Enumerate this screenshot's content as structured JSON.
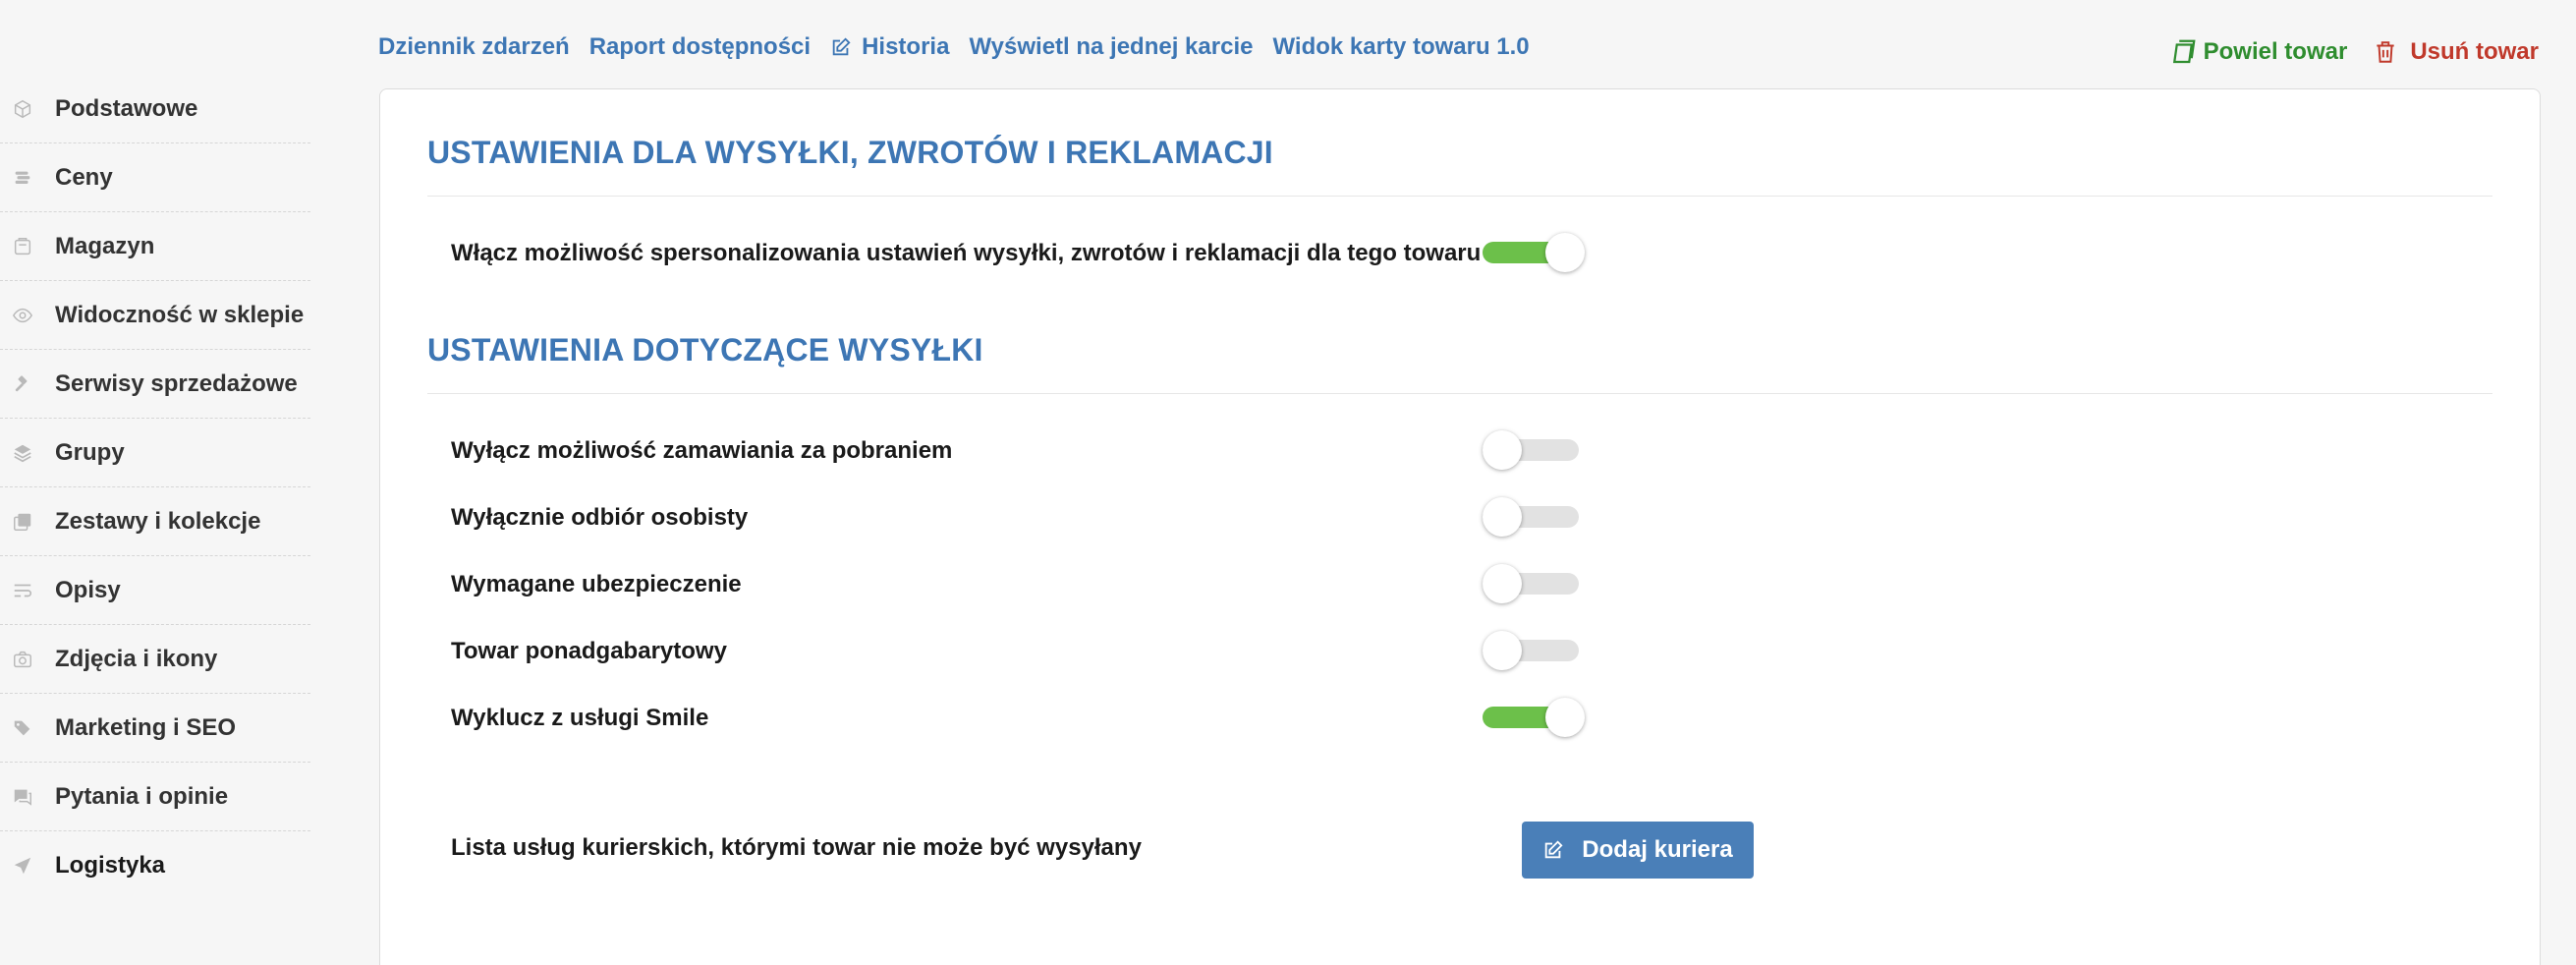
{
  "sidebar": {
    "items": [
      {
        "label": "Podstawowe",
        "icon": "box-icon"
      },
      {
        "label": "Ceny",
        "icon": "coins-icon"
      },
      {
        "label": "Magazyn",
        "icon": "warehouse-icon"
      },
      {
        "label": "Widoczność w sklepie",
        "icon": "eye-icon"
      },
      {
        "label": "Serwisy sprzedażowe",
        "icon": "gavel-icon"
      },
      {
        "label": "Grupy",
        "icon": "layers-icon"
      },
      {
        "label": "Zestawy i kolekcje",
        "icon": "collection-icon"
      },
      {
        "label": "Opisy",
        "icon": "text-wrap-icon"
      },
      {
        "label": "Zdjęcia i ikony",
        "icon": "camera-icon"
      },
      {
        "label": "Marketing i SEO",
        "icon": "tags-icon"
      },
      {
        "label": "Pytania i opinie",
        "icon": "comments-icon"
      },
      {
        "label": "Logistyka",
        "icon": "paper-plane-icon",
        "active": true
      }
    ]
  },
  "toplinks": {
    "event_log": "Dziennik zdarzeń",
    "availability_report": "Raport dostępności",
    "history": "Historia",
    "single_card": "Wyświetl na jednej karcie",
    "card_view": "Widok karty towaru 1.0"
  },
  "actions": {
    "duplicate": "Powiel towar",
    "delete": "Usuń towar"
  },
  "colors": {
    "accent": "#3d76b4",
    "toggle_on": "#6cc04a",
    "duplicate": "#2f8d2f",
    "delete": "#c0392b",
    "button": "#4a7fb8"
  },
  "section1": {
    "title": "USTAWIENIA DLA WYSYŁKI, ZWROTÓW I REKLAMACJI",
    "personalize_label": "Włącz możliwość spersonalizowania ustawień wysyłki, zwrotów i reklamacji dla tego towaru",
    "personalize_on": true
  },
  "section2": {
    "title": "USTAWIENIA DOTYCZĄCE WYSYŁKI",
    "options": [
      {
        "label": "Wyłącz możliwość zamawiania za pobraniem",
        "on": false
      },
      {
        "label": "Wyłącznie odbiór osobisty",
        "on": false
      },
      {
        "label": "Wymagane ubezpieczenie",
        "on": false
      },
      {
        "label": "Towar ponadgabarytowy",
        "on": false
      },
      {
        "label": "Wyklucz z usługi Smile",
        "on": true
      }
    ],
    "couriers_label": "Lista usług kurierskich, którymi towar nie może być wysyłany",
    "add_courier_button": "Dodaj kuriera"
  }
}
